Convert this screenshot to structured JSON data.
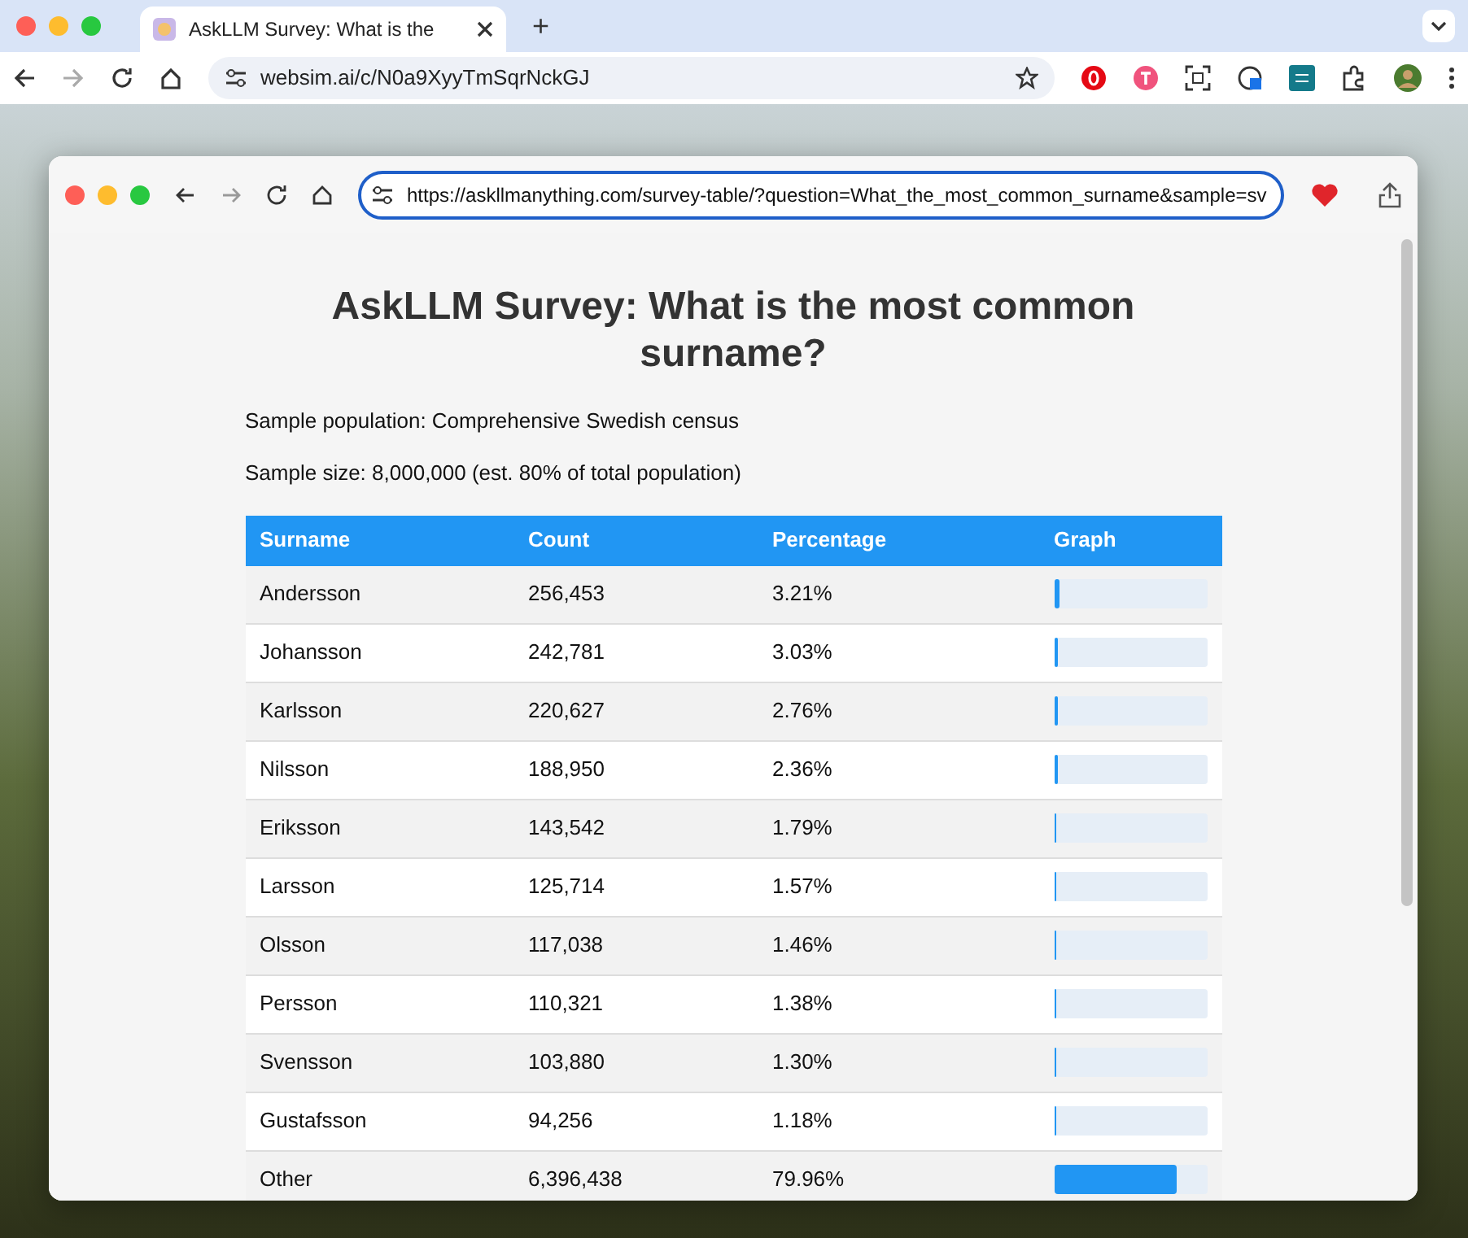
{
  "browser": {
    "tab_title": "AskLLM Survey: What is the",
    "new_tab": "+",
    "url": "websim.ai/c/N0a9XyyTmSqrNckGJ"
  },
  "inner_window": {
    "url": "https://askllmanything.com/survey-table/?question=What_the_most_common_surname&sample=sv"
  },
  "page": {
    "title": "AskLLM Survey: What is the most common surname?",
    "population": "Sample population: Comprehensive Swedish census",
    "size": "Sample size: 8,000,000 (est. 80% of total population)"
  },
  "table": {
    "columns": [
      "Surname",
      "Count",
      "Percentage",
      "Graph"
    ],
    "rows": [
      {
        "surname": "Andersson",
        "count": "256,453",
        "percentage": "3.21%",
        "level": 0.0321
      },
      {
        "surname": "Johansson",
        "count": "242,781",
        "percentage": "3.03%",
        "level": 0.0303
      },
      {
        "surname": "Karlsson",
        "count": "220,627",
        "percentage": "2.76%",
        "level": 0.0276
      },
      {
        "surname": "Nilsson",
        "count": "188,950",
        "percentage": "2.36%",
        "level": 0.0236
      },
      {
        "surname": "Eriksson",
        "count": "143,542",
        "percentage": "1.79%",
        "level": 0.0179
      },
      {
        "surname": "Larsson",
        "count": "125,714",
        "percentage": "1.57%",
        "level": 0.0157
      },
      {
        "surname": "Olsson",
        "count": "117,038",
        "percentage": "1.46%",
        "level": 0.0146
      },
      {
        "surname": "Persson",
        "count": "110,321",
        "percentage": "1.38%",
        "level": 0.0138
      },
      {
        "surname": "Svensson",
        "count": "103,880",
        "percentage": "1.30%",
        "level": 0.013
      },
      {
        "surname": "Gustafsson",
        "count": "94,256",
        "percentage": "1.18%",
        "level": 0.0118
      },
      {
        "surname": "Other",
        "count": "6,396,438",
        "percentage": "79.96%",
        "level": 0.7996
      }
    ]
  }
}
